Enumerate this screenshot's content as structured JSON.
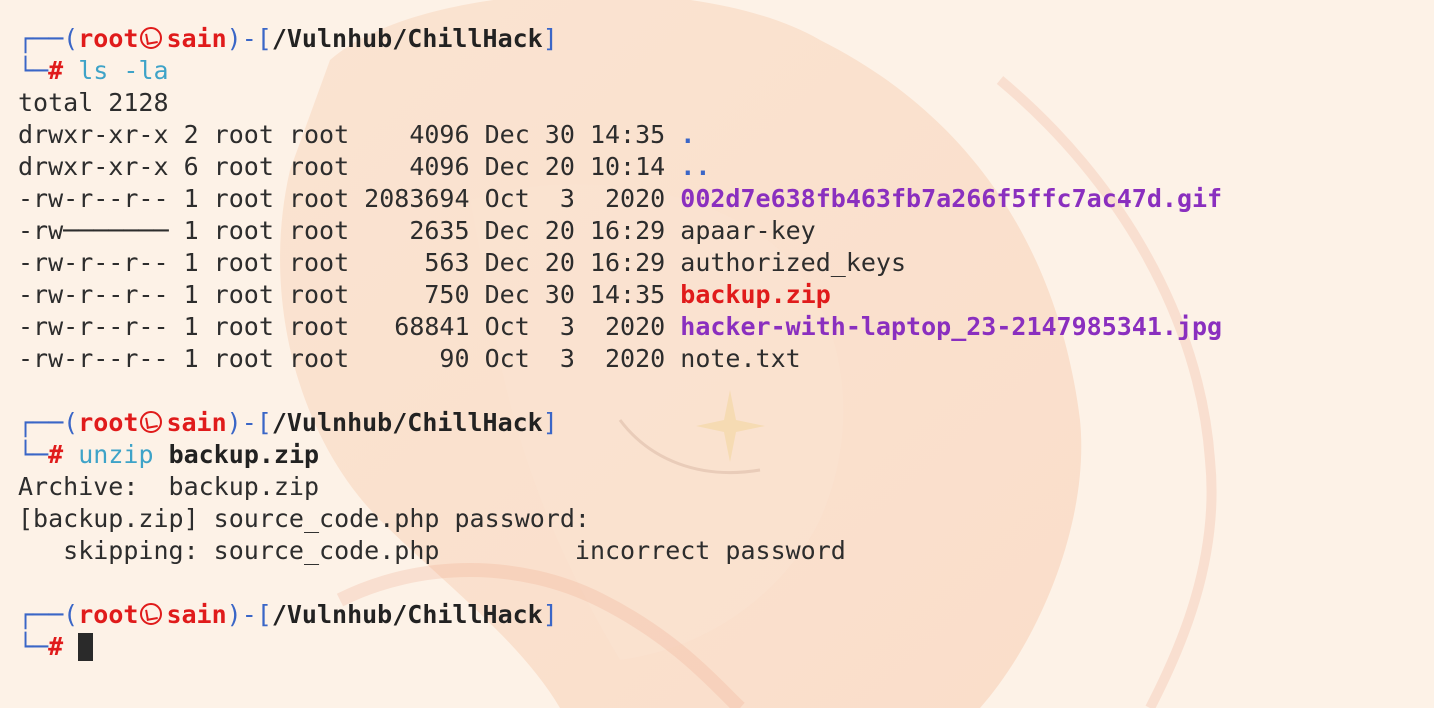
{
  "prompt": {
    "user": "root",
    "host": "sain",
    "cwd": "/Vulnhub/ChillHack",
    "corner_top": "┌──(",
    "corner_bottom": "└─",
    "close_user": ")-[",
    "close_path": "]",
    "hash": "#"
  },
  "blocks": [
    {
      "command": "ls",
      "args": "-la",
      "output": {
        "total": "total 2128",
        "rows": [
          {
            "meta": "drwxr-xr-x 2 root root    4096 Dec 30 14:35 ",
            "name": ".",
            "type": "dir"
          },
          {
            "meta": "drwxr-xr-x 6 root root    4096 Dec 20 10:14 ",
            "name": "..",
            "type": "dir"
          },
          {
            "meta": "-rw-r--r-- 1 root root 2083694 Oct  3  2020 ",
            "name": "002d7e638fb463fb7a266f5ffc7ac47d.gif",
            "type": "image"
          },
          {
            "meta": "-rw─────── 1 root root    2635 Dec 20 16:29 ",
            "name": "apaar-key",
            "type": "file"
          },
          {
            "meta": "-rw-r--r-- 1 root root     563 Dec 20 16:29 ",
            "name": "authorized_keys",
            "type": "file"
          },
          {
            "meta": "-rw-r--r-- 1 root root     750 Dec 30 14:35 ",
            "name": "backup.zip",
            "type": "archive"
          },
          {
            "meta": "-rw-r--r-- 1 root root   68841 Oct  3  2020 ",
            "name": "hacker-with-laptop_23-2147985341.jpg",
            "type": "image"
          },
          {
            "meta": "-rw-r--r-- 1 root root      90 Oct  3  2020 ",
            "name": "note.txt",
            "type": "file"
          }
        ]
      }
    },
    {
      "command": "unzip",
      "args": "backup.zip",
      "output": {
        "lines": [
          "Archive:  backup.zip",
          "[backup.zip] source_code.php password: ",
          "   skipping: source_code.php         incorrect password"
        ]
      }
    }
  ],
  "colors": {
    "prompt_frame": "#3a66c7",
    "user_host": "#e01b1b",
    "command": "#3ea3c8",
    "image_file": "#8a2fbf",
    "archive_file": "#e01b1b",
    "background": "#fdf2e7"
  },
  "icons": {
    "user_host_separator": "kali-skull-icon"
  }
}
